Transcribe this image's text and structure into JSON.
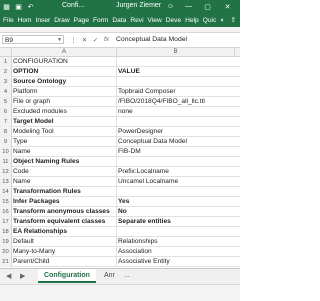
{
  "window": {
    "title": "Confi...",
    "user": "Jurgen Ziemer",
    "minimize": "—",
    "maximize": "▢",
    "close": "✕"
  },
  "ribbon": {
    "tabs": [
      "File",
      "Hom",
      "Inser",
      "Draw",
      "Page",
      "Form",
      "Data",
      "Revi",
      "View",
      "Deve",
      "Help",
      "Quic"
    ]
  },
  "formula_bar": {
    "name_box": "B9",
    "formula": "Conceptual Data Model"
  },
  "columns": [
    "A",
    "B"
  ],
  "rows": [
    {
      "num": "1",
      "a": "CONFIGURATION",
      "b": "",
      "bold": false
    },
    {
      "num": "2",
      "a": "OPTION",
      "b": "VALUE",
      "bold": true
    },
    {
      "num": "3",
      "a": "Source Ontology",
      "b": "",
      "bold": true
    },
    {
      "num": "4",
      "a": "Platform",
      "b": "Topbraid Composer",
      "bold": false
    },
    {
      "num": "5",
      "a": "File or graph",
      "b": "/FIBO/2018Q4/FIBO_all_llc.ttl",
      "bold": false
    },
    {
      "num": "6",
      "a": "Excluded modules",
      "b": "none",
      "bold": false
    },
    {
      "num": "7",
      "a": "Target Model",
      "b": "",
      "bold": true
    },
    {
      "num": "8",
      "a": "Modeling Tool",
      "b": "PowerDesigner",
      "bold": false
    },
    {
      "num": "9",
      "a": "Type",
      "b": "Conceptual Data Model",
      "bold": false
    },
    {
      "num": "10",
      "a": "Name",
      "b": "FIB-DM",
      "bold": false
    },
    {
      "num": "11",
      "a": "Object Naming Rules",
      "b": "",
      "bold": true
    },
    {
      "num": "12",
      "a": "Code",
      "b": "Prefix:Localname",
      "bold": false
    },
    {
      "num": "13",
      "a": "Name",
      "b": "Uncamel Localname",
      "bold": false
    },
    {
      "num": "14",
      "a": "Transformation Rules",
      "b": "",
      "bold": true
    },
    {
      "num": "15",
      "a": "Infer Packages",
      "b": "Yes",
      "bold": true
    },
    {
      "num": "16",
      "a": "Transform anonymous classes",
      "b": "No",
      "bold": true
    },
    {
      "num": "17",
      "a": "Transform equivalent classes",
      "b": "Separate entities",
      "bold": true
    },
    {
      "num": "18",
      "a": "EA Relationships",
      "b": "",
      "bold": true
    },
    {
      "num": "19",
      "a": "Default",
      "b": "Relationships",
      "bold": false
    },
    {
      "num": "20",
      "a": "Many-to-Many",
      "b": "Association",
      "bold": false
    },
    {
      "num": "21",
      "a": "Parent/Child",
      "b": "Associative Entity",
      "bold": false
    }
  ],
  "sheets": {
    "active": "Configuration",
    "next": "Anr",
    "more": "..."
  },
  "icons": {
    "excel": "excel-icon",
    "account": "account-icon",
    "share": "share-icon",
    "lightbulb": "lightbulb-icon",
    "cancel": "cancel-icon",
    "enter": "enter-icon",
    "fx": "fx-icon"
  },
  "colors": {
    "excel_green": "#217346"
  }
}
